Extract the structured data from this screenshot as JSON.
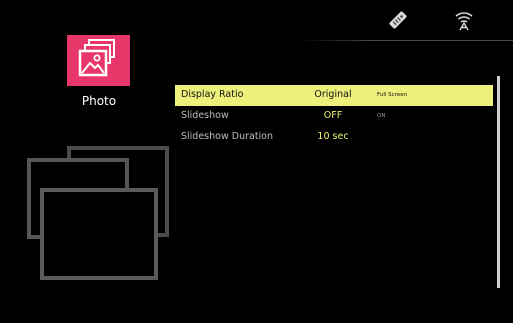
{
  "status_bar": {
    "icons": [
      "remote-icon",
      "wifi-icon"
    ]
  },
  "category": {
    "label": "Photo",
    "icon": "photo-gallery-icon",
    "tile_color": "#e8356a"
  },
  "settings": {
    "rows": [
      {
        "label": "Display Ratio",
        "value": "Original",
        "option": "Full Screen",
        "selected": true
      },
      {
        "label": "Slideshow",
        "value": "OFF",
        "option": "ON",
        "selected": false
      },
      {
        "label": "Slideshow Duration",
        "value": "10 sec",
        "option": "",
        "selected": false
      }
    ]
  },
  "colors": {
    "highlight": "#eef07c",
    "value_text": "#f0f07a",
    "label_text": "#bdbdbd"
  }
}
